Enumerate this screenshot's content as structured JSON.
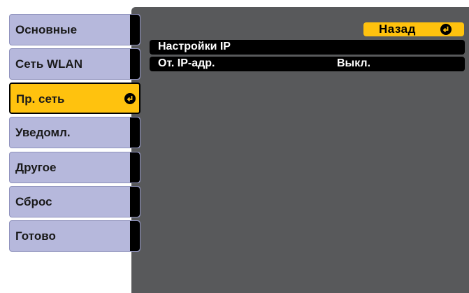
{
  "sidebar": {
    "items": [
      {
        "label": "Основные"
      },
      {
        "label": "Сеть WLAN"
      },
      {
        "label": "Пр. сеть"
      },
      {
        "label": "Уведомл."
      },
      {
        "label": "Другое"
      },
      {
        "label": "Сброс"
      },
      {
        "label": "Готово"
      }
    ],
    "selected_index": 2
  },
  "main": {
    "back_label": "Назад",
    "rows": [
      {
        "label": "Настройки IP",
        "value": ""
      },
      {
        "label": "От. IP-адр.",
        "value": "Выкл."
      }
    ]
  },
  "colors": {
    "selected": "#ffc20e",
    "menu_item": "#b6b8dc",
    "panel": "#58595b",
    "row": "#000000"
  },
  "icons": {
    "enter": "enter-icon"
  }
}
